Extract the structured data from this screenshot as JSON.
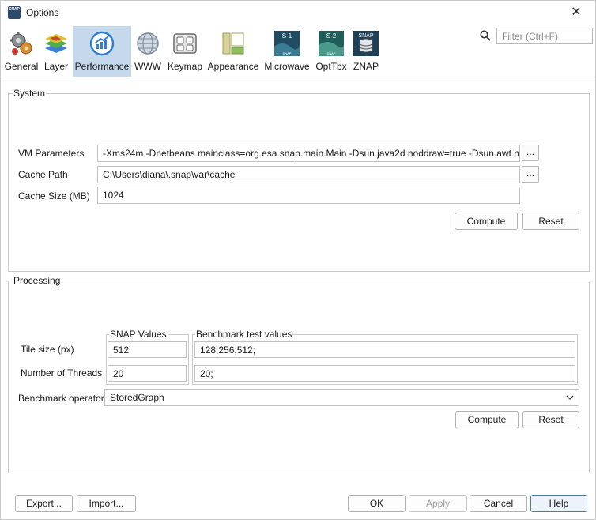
{
  "window": {
    "title": "Options",
    "app_icon": "snap-app-icon",
    "close_icon": "close-icon",
    "close_glyph": "✕"
  },
  "categories": [
    {
      "label": "General",
      "icon": "gears-icon",
      "selected": false
    },
    {
      "label": "Layer",
      "icon": "layers-icon",
      "selected": false
    },
    {
      "label": "Performance",
      "icon": "performance-gauge-icon",
      "selected": true
    },
    {
      "label": "WWW",
      "icon": "globe-icon",
      "selected": false
    },
    {
      "label": "Keymap",
      "icon": "keyboard-icon",
      "selected": false
    },
    {
      "label": "Appearance",
      "icon": "appearance-layout-icon",
      "selected": false
    },
    {
      "label": "Microwave",
      "icon": "sentinel-1-icon",
      "selected": false
    },
    {
      "label": "OptTbx",
      "icon": "sentinel-2-icon",
      "selected": false
    },
    {
      "label": "ZNAP",
      "icon": "znap-database-icon",
      "selected": false
    }
  ],
  "filter": {
    "placeholder": "Filter (Ctrl+F)",
    "value": "",
    "icon": "search-icon"
  },
  "system": {
    "title": "System",
    "vm_parameters_label": "VM Parameters",
    "vm_parameters_value": "-Xms24m -Dnetbeans.mainclass=org.esa.snap.main.Main -Dsun.java2d.noddraw=true -Dsun.awt.n",
    "cache_path_label": "Cache Path",
    "cache_path_value": "C:\\Users\\diana\\.snap\\var\\cache",
    "cache_size_label": "Cache Size (MB)",
    "cache_size_value": "1024",
    "browse_label": "...",
    "compute_label": "Compute",
    "reset_label": "Reset"
  },
  "processing": {
    "title": "Processing",
    "snap_values_title": "SNAP Values",
    "benchmark_values_title": "Benchmark test values",
    "tile_size_label": "Tile size (px)",
    "tile_size_value": "512",
    "tile_size_benchmark": "128;256;512;",
    "threads_label": "Number of Threads",
    "threads_value": "20",
    "threads_benchmark": "20;",
    "benchmark_operator_label": "Benchmark operator",
    "benchmark_operator_value": "StoredGraph",
    "compute_label": "Compute",
    "reset_label": "Reset"
  },
  "footer": {
    "export_label": "Export...",
    "import_label": "Import...",
    "ok_label": "OK",
    "apply_label": "Apply",
    "cancel_label": "Cancel",
    "help_label": "Help"
  }
}
